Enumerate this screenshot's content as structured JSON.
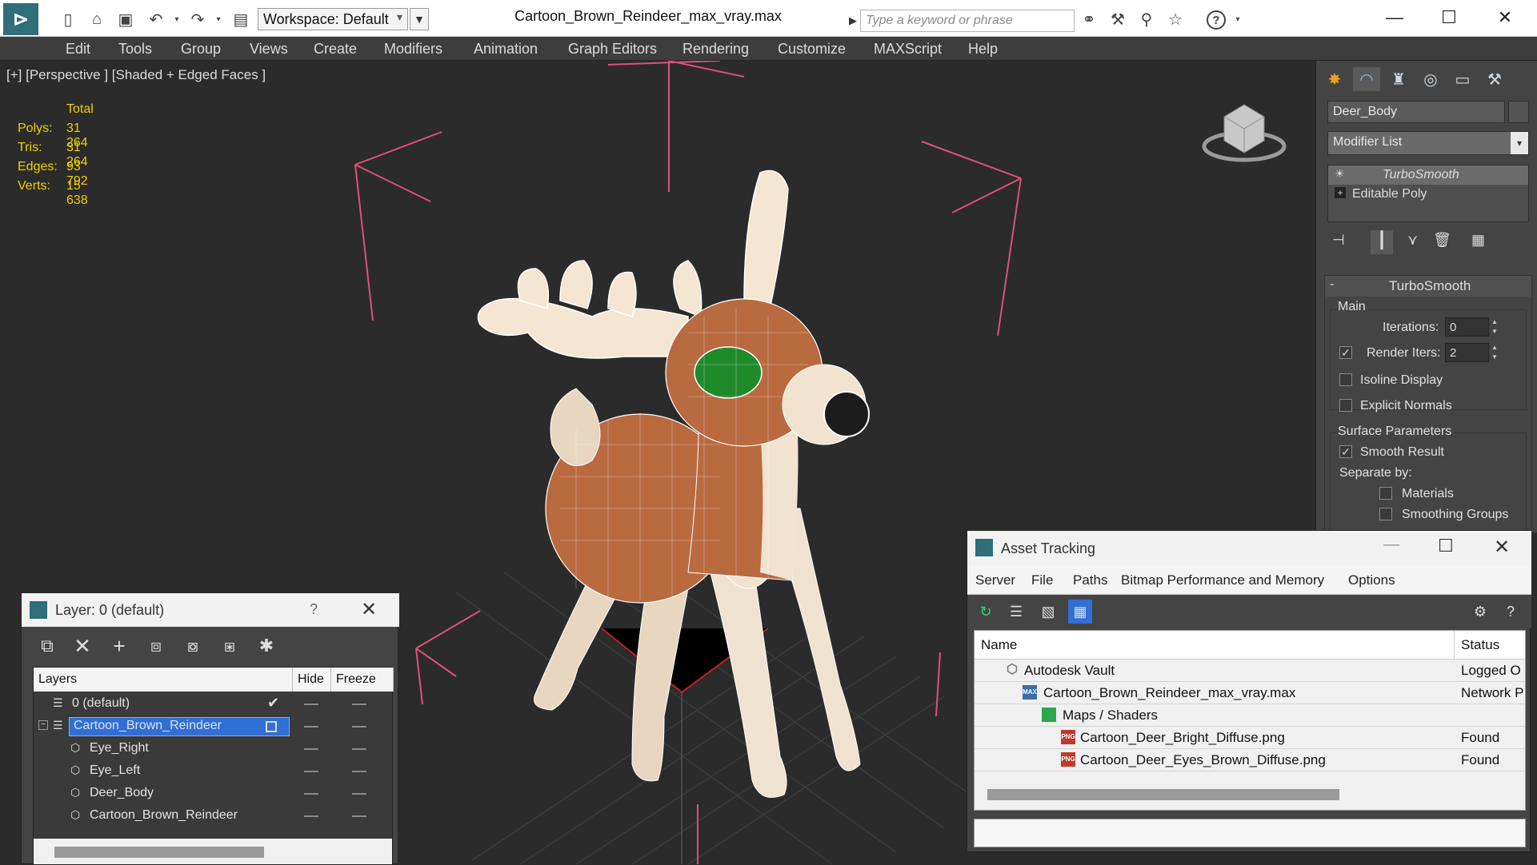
{
  "app": {
    "workspace_label": "Workspace: Default",
    "document_title": "Cartoon_Brown_Reindeer_max_vray.max",
    "search_placeholder": "Type a keyword or phrase"
  },
  "menu": [
    "Edit",
    "Tools",
    "Group",
    "Views",
    "Create",
    "Modifiers",
    "Animation",
    "Graph Editors",
    "Rendering",
    "Customize",
    "MAXScript",
    "Help"
  ],
  "viewport": {
    "label": "[+] [Perspective ] [Shaded + Edged Faces ]",
    "stats": {
      "header": "Total",
      "rows": [
        {
          "key": "Polys:",
          "value": "31 264"
        },
        {
          "key": "Tris:",
          "value": "31 264"
        },
        {
          "key": "Edges:",
          "value": "93 792"
        },
        {
          "key": "Verts:",
          "value": "15 638"
        }
      ]
    }
  },
  "command_panel": {
    "object_name": "Deer_Body",
    "modifier_list_label": "Modifier List",
    "stack": [
      "TurboSmooth",
      "Editable Poly"
    ],
    "rollout_title": "TurboSmooth",
    "main_group": "Main",
    "iterations_label": "Iterations:",
    "iterations_value": "0",
    "render_iters_label": "Render Iters:",
    "render_iters_value": "2",
    "render_iters_checked": true,
    "isoline_label": "Isoline Display",
    "isoline_checked": false,
    "explicit_normals_label": "Explicit Normals",
    "explicit_normals_checked": false,
    "surface_params_label": "Surface Parameters",
    "smooth_result_label": "Smooth Result",
    "smooth_result_checked": true,
    "separate_by_label": "Separate by:",
    "materials_label": "Materials",
    "materials_checked": false,
    "smoothing_groups_label": "Smoothing Groups"
  },
  "layer_window": {
    "title": "Layer: 0 (default)",
    "help_label": "?",
    "columns": [
      "Layers",
      "Hide",
      "Freeze"
    ],
    "rows": [
      {
        "name": "0 (default)",
        "level": 0,
        "selected": false,
        "active": true
      },
      {
        "name": "Cartoon_Brown_Reindeer",
        "level": 0,
        "selected": true,
        "active": false
      },
      {
        "name": "Eye_Right",
        "level": 1,
        "selected": false,
        "active": false
      },
      {
        "name": "Eye_Left",
        "level": 1,
        "selected": false,
        "active": false
      },
      {
        "name": "Deer_Body",
        "level": 1,
        "selected": false,
        "active": false
      },
      {
        "name": "Cartoon_Brown_Reindeer",
        "level": 1,
        "selected": false,
        "active": false
      }
    ]
  },
  "asset_tracking": {
    "title": "Asset Tracking",
    "menu": [
      "Server",
      "File",
      "Paths",
      "Bitmap Performance and Memory",
      "Options"
    ],
    "columns": [
      "Name",
      "Status"
    ],
    "rows": [
      {
        "name": "Autodesk Vault",
        "status": "Logged O",
        "level": 1,
        "icon": "vault-icon"
      },
      {
        "name": "Cartoon_Brown_Reindeer_max_vray.max",
        "status": "Network P",
        "level": 2,
        "icon": "max-file-icon"
      },
      {
        "name": "Maps / Shaders",
        "status": "",
        "level": 3,
        "icon": "maps-folder-icon"
      },
      {
        "name": "Cartoon_Deer_Bright_Diffuse.png",
        "status": "Found",
        "level": 4,
        "icon": "png-file-icon"
      },
      {
        "name": "Cartoon_Deer_Eyes_Brown_Diffuse.png",
        "status": "Found",
        "level": 4,
        "icon": "png-file-icon"
      }
    ]
  },
  "colors": {
    "viewport_bg": "#2b2b2b",
    "stats_text": "#f0d000",
    "selection_blue": "#2f6fd6",
    "deer_brown": "#b8683e",
    "deer_cream": "#f3e6d4",
    "eye_green": "#1f8a2a"
  }
}
